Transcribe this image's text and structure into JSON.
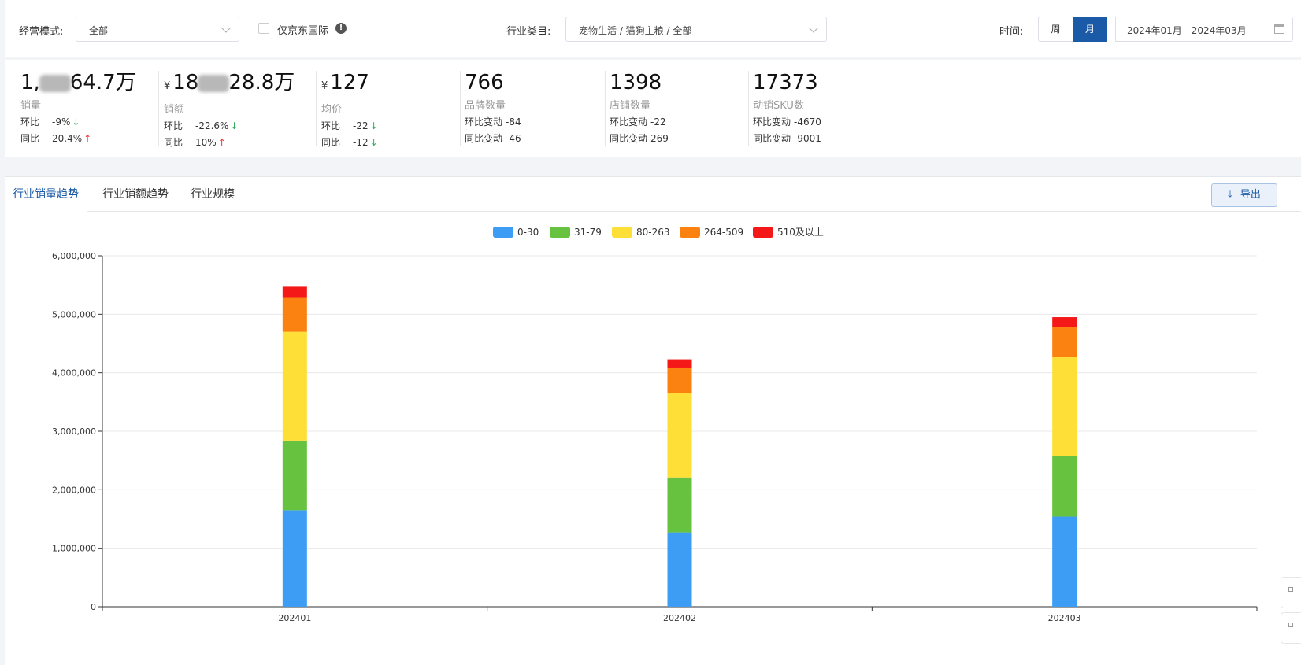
{
  "filters": {
    "mode_label": "经营模式:",
    "mode_value": "全部",
    "jd_intl_label": "仅京东国际",
    "category_label": "行业类目:",
    "category_value": "宠物生活 / 猫狗主粮 / 全部",
    "time_label": "时间:",
    "period_week": "周",
    "period_month": "月",
    "date_range": "2024年01月 - 2024年03月"
  },
  "kpis": [
    {
      "prefix": "",
      "head": "1,",
      "tail": "64.7万",
      "name": "销量",
      "r1k": "环比",
      "r1v": "-9%",
      "r1arrow": "↓",
      "r2k": "同比",
      "r2v": "20.4%",
      "r2arrow": "↑"
    },
    {
      "prefix": "¥",
      "head": "18",
      "tail": "28.8万",
      "name": "销额",
      "r1k": "环比",
      "r1v": "-22.6%",
      "r1arrow": "↓",
      "r2k": "同比",
      "r2v": "10%",
      "r2arrow": "↑"
    },
    {
      "prefix": "¥",
      "head": "127",
      "tail": "",
      "name": "均价",
      "r1k": "环比",
      "r1v": "-22",
      "r1arrow": "↓",
      "r2k": "同比",
      "r2v": "-12",
      "r2arrow": "↓"
    },
    {
      "prefix": "",
      "head": "766",
      "tail": "",
      "name": "品牌数量",
      "r1k": "环比变动",
      "r1v": "-84",
      "r1arrow": "",
      "r2k": "同比变动",
      "r2v": "-46",
      "r2arrow": ""
    },
    {
      "prefix": "",
      "head": "1398",
      "tail": "",
      "name": "店铺数量",
      "r1k": "环比变动",
      "r1v": "-22",
      "r1arrow": "",
      "r2k": "同比变动",
      "r2v": "269",
      "r2arrow": ""
    },
    {
      "prefix": "",
      "head": "17373",
      "tail": "",
      "name": "动销SKU数",
      "r1k": "环比变动",
      "r1v": "-4670",
      "r1arrow": "",
      "r2k": "同比变动",
      "r2v": "-9001",
      "r2arrow": ""
    }
  ],
  "tabs": {
    "volume_trend": "行业销量趋势",
    "sales_trend": "行业销额趋势",
    "scale": "行业规模"
  },
  "export_label": "导出",
  "icons": {
    "export": "download-icon",
    "calendar": "calendar-icon",
    "info": "info-icon",
    "dropdown": "chevron-down-icon"
  },
  "chart_data": {
    "type": "bar",
    "stacked": true,
    "categories": [
      "202401",
      "202402",
      "202403"
    ],
    "ylim": [
      0,
      6000000
    ],
    "yticks": [
      0,
      1000000,
      2000000,
      3000000,
      4000000,
      5000000,
      6000000
    ],
    "ytick_labels": [
      "0",
      "1,000,000",
      "2,000,000",
      "3,000,000",
      "4,000,000",
      "5,000,000",
      "6,000,000"
    ],
    "legend_position": "top-center",
    "grid": true,
    "series": [
      {
        "name": "0-30",
        "color": "#3d9df5",
        "values": [
          1650000,
          1270000,
          1540000
        ]
      },
      {
        "name": "31-79",
        "color": "#66c23f",
        "values": [
          1190000,
          940000,
          1040000
        ]
      },
      {
        "name": "80-263",
        "color": "#fddf37",
        "values": [
          1860000,
          1440000,
          1690000
        ]
      },
      {
        "name": "264-509",
        "color": "#fb8110",
        "values": [
          580000,
          440000,
          510000
        ]
      },
      {
        "name": "510及以上",
        "color": "#f41818",
        "values": [
          190000,
          140000,
          170000
        ]
      }
    ]
  }
}
